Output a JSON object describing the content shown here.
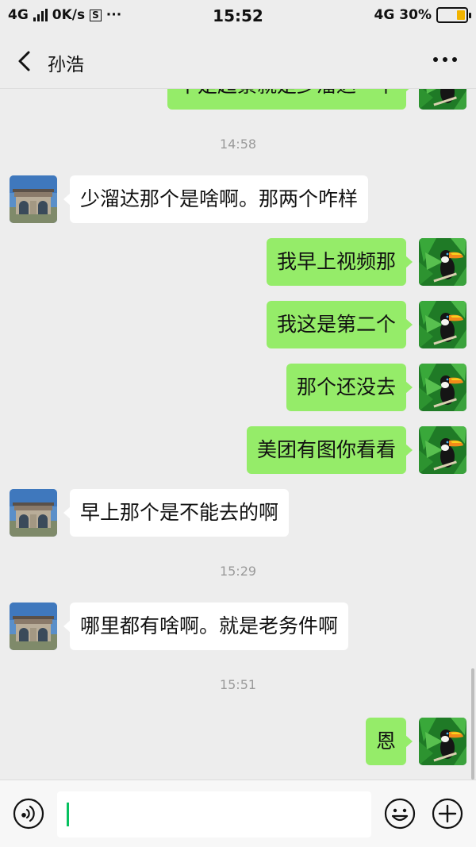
{
  "status_bar": {
    "network_left": "4G",
    "speed": "0K/s",
    "s_badge": "S",
    "dots": "···",
    "time": "15:52",
    "network_right": "4G",
    "battery": "30%",
    "battery_level": 0.3,
    "battery_color": "#f2b400"
  },
  "header": {
    "title": "孙浩",
    "back_icon": "chevron-left-icon",
    "more_icon": "more-dots-icon"
  },
  "messages": {
    "partial_top": "不是超景就是少溜达一个",
    "ts1": "14:58",
    "m1": "少溜达那个是啥啊。那两个咋样",
    "m2": "我早上视频那",
    "m3": "我这是第二个",
    "m4": "那个还没去",
    "m5": "美团有图你看看",
    "m6": "早上那个是不能去的啊",
    "ts2": "15:29",
    "m7": "哪里都有啥啊。就是老务件啊",
    "ts3": "15:51",
    "m8": "恩"
  },
  "input_bar": {
    "voice_icon": "voice-icon",
    "emoji_icon": "emoji-icon",
    "plus_icon": "plus-icon",
    "text_value": ""
  },
  "colors": {
    "background": "#ededed",
    "outgoing_bubble": "#95ec69",
    "incoming_bubble": "#ffffff",
    "accent": "#07c160"
  }
}
